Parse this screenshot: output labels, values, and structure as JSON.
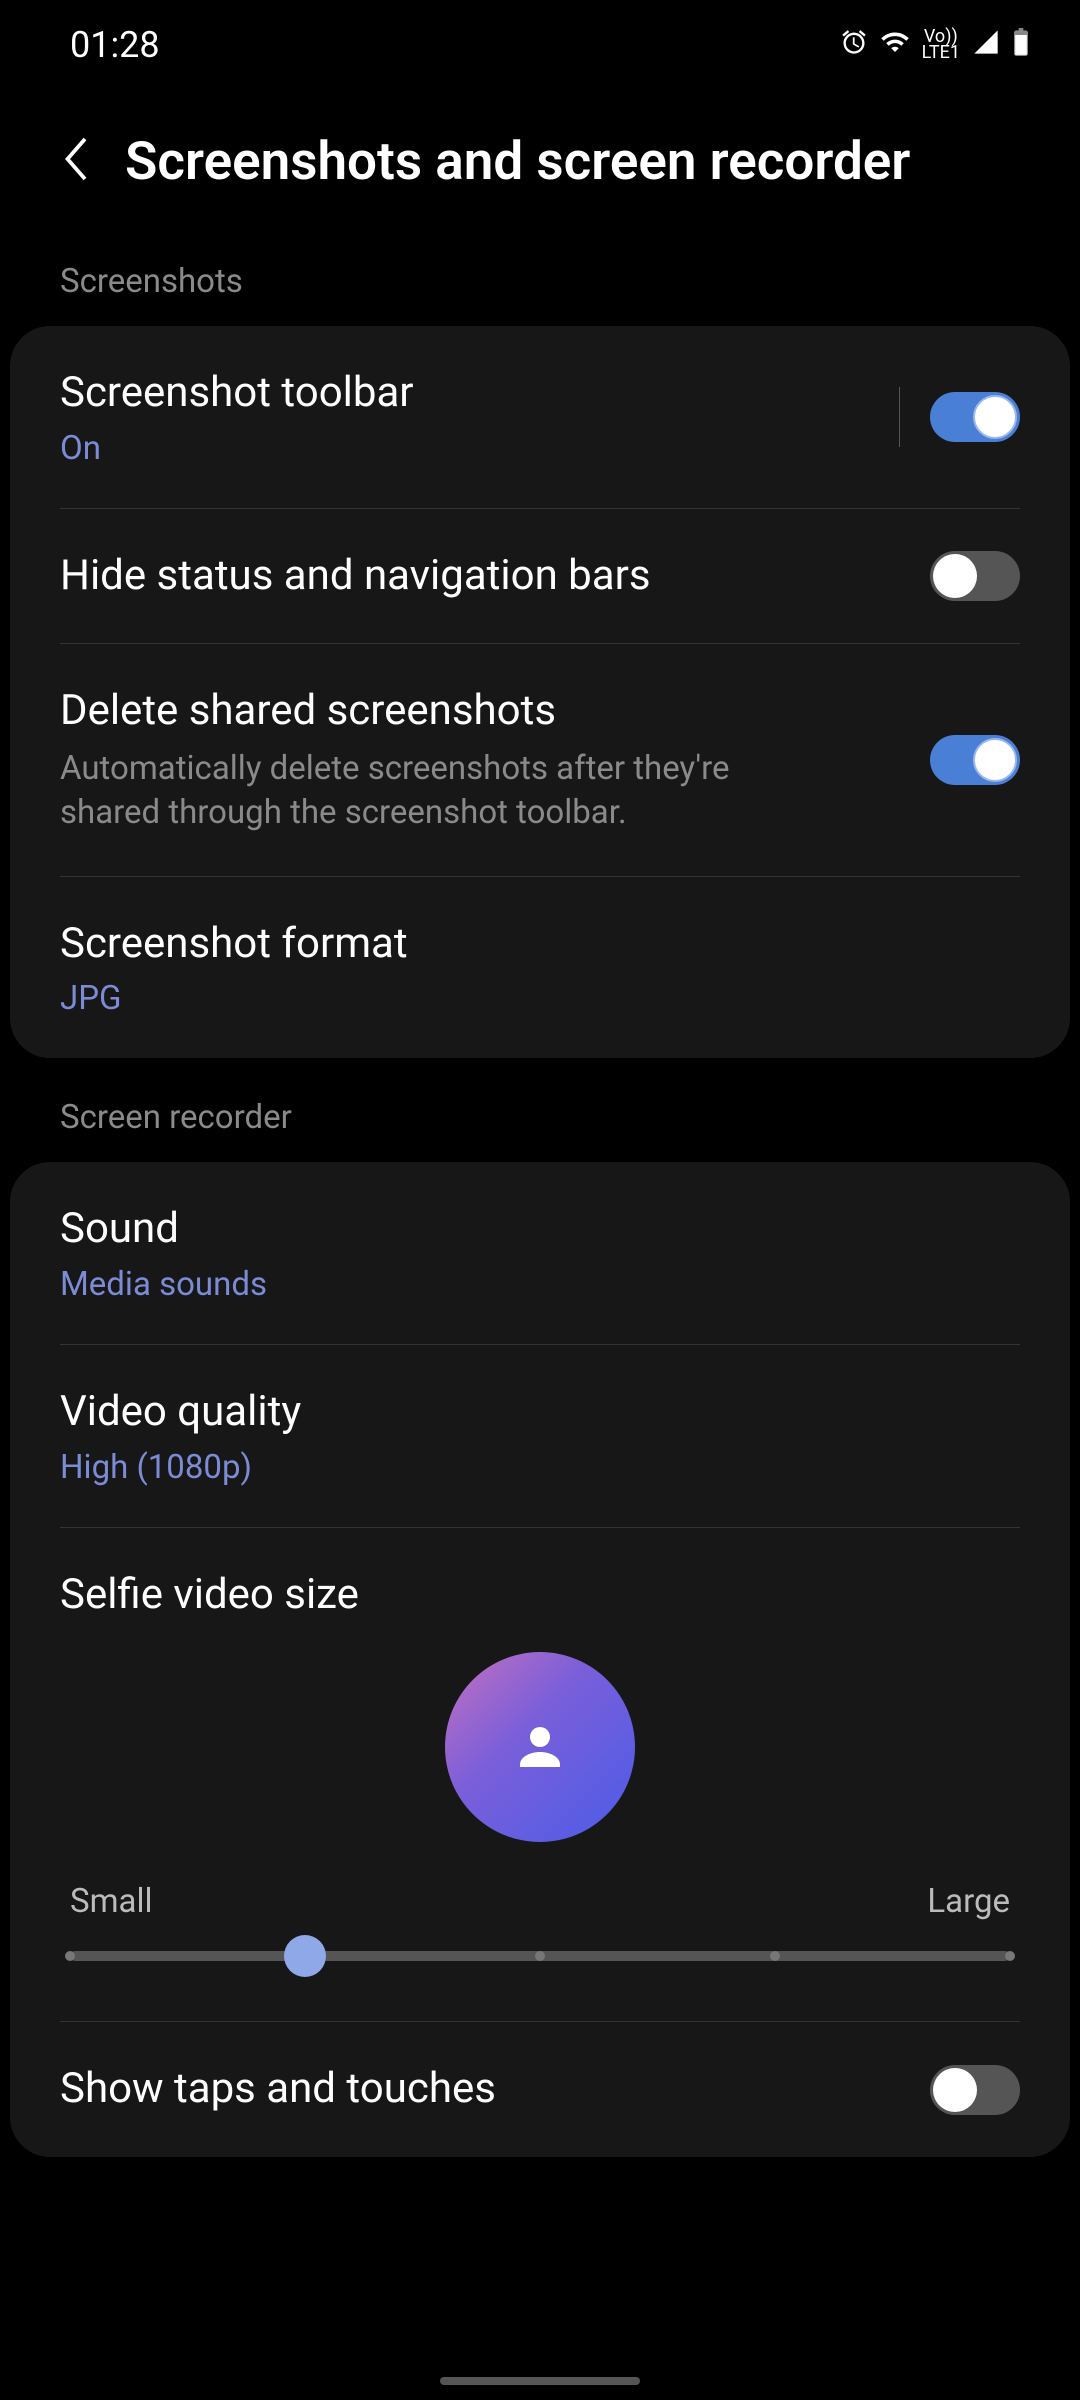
{
  "statusBar": {
    "time": "01:28",
    "lteLabel1": "Vo))",
    "lteLabel2": "LTE1"
  },
  "header": {
    "title": "Screenshots and screen recorder"
  },
  "sections": {
    "screenshots": {
      "label": "Screenshots",
      "items": {
        "toolbar": {
          "title": "Screenshot toolbar",
          "status": "On",
          "toggle": true
        },
        "hideBars": {
          "title": "Hide status and navigation bars",
          "toggle": false
        },
        "deleteShared": {
          "title": "Delete shared screenshots",
          "desc": "Automatically delete screenshots after they're shared through the screenshot toolbar.",
          "toggle": true
        },
        "format": {
          "title": "Screenshot format",
          "value": "JPG"
        }
      }
    },
    "recorder": {
      "label": "Screen recorder",
      "items": {
        "sound": {
          "title": "Sound",
          "value": "Media sounds"
        },
        "quality": {
          "title": "Video quality",
          "value": "High (1080p)"
        },
        "selfieSize": {
          "title": "Selfie video size",
          "sliderMin": "Small",
          "sliderMax": "Large",
          "sliderSteps": 5,
          "sliderValue": 1
        },
        "showTaps": {
          "title": "Show taps and touches",
          "toggle": false
        }
      }
    }
  }
}
